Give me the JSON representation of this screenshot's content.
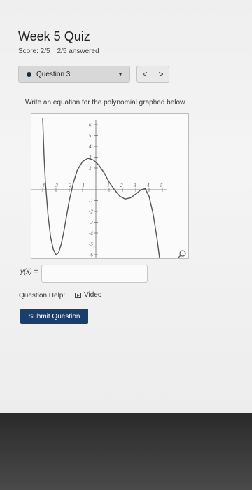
{
  "quiz": {
    "title": "Week 5 Quiz",
    "score": "Score: 2/5",
    "answered": "2/5 answered"
  },
  "question_selector": {
    "label": "Question 3",
    "caret": "▾"
  },
  "nav": {
    "prev": "<",
    "next": ">"
  },
  "question": {
    "text": "Write an equation for the polynomial graphed below"
  },
  "graph": {
    "x_ticks": [
      "-5",
      "-4",
      "-3",
      "-2",
      "-1",
      "1",
      "2",
      "3",
      "4",
      "5"
    ],
    "y_ticks": [
      "6",
      "5",
      "4",
      "3",
      "2",
      "-1",
      "-2",
      "-3",
      "-4",
      "-5",
      "-6"
    ],
    "icons": [
      "magnify-icon"
    ]
  },
  "chart_data": {
    "type": "line",
    "xlim": [
      -5,
      5
    ],
    "ylim": [
      -6,
      6
    ],
    "grid": false,
    "series": [
      {
        "points": [
          [
            -4.0,
            6.6
          ],
          [
            -3.9,
            3.2
          ],
          [
            -3.8,
            0.8
          ],
          [
            -3.6,
            -2.3
          ],
          [
            -3.4,
            -4.4
          ],
          [
            -3.2,
            -5.5
          ],
          [
            -3.0,
            -6.0
          ],
          [
            -2.8,
            -5.8
          ],
          [
            -2.6,
            -5.0
          ],
          [
            -2.4,
            -3.8
          ],
          [
            -2.2,
            -2.4
          ],
          [
            -2.0,
            -1.0
          ],
          [
            -1.7,
            0.6
          ],
          [
            -1.4,
            1.8
          ],
          [
            -1.0,
            2.6
          ],
          [
            -0.6,
            2.9
          ],
          [
            -0.2,
            2.75
          ],
          [
            0.2,
            2.3
          ],
          [
            0.6,
            1.6
          ],
          [
            1.0,
            0.7
          ],
          [
            1.4,
            0.0
          ],
          [
            1.8,
            -0.6
          ],
          [
            2.2,
            -0.85
          ],
          [
            2.6,
            -0.75
          ],
          [
            3.0,
            -0.4
          ],
          [
            3.4,
            0.0
          ],
          [
            3.7,
            0.1
          ],
          [
            4.0,
            -0.6
          ],
          [
            4.3,
            -2.2
          ],
          [
            4.6,
            -4.5
          ],
          [
            4.8,
            -6.4
          ]
        ]
      }
    ]
  },
  "answer": {
    "label": "y(x) =",
    "value": ""
  },
  "help": {
    "label": "Question Help:",
    "video": "Video"
  },
  "submit": {
    "label": "Submit Question"
  }
}
